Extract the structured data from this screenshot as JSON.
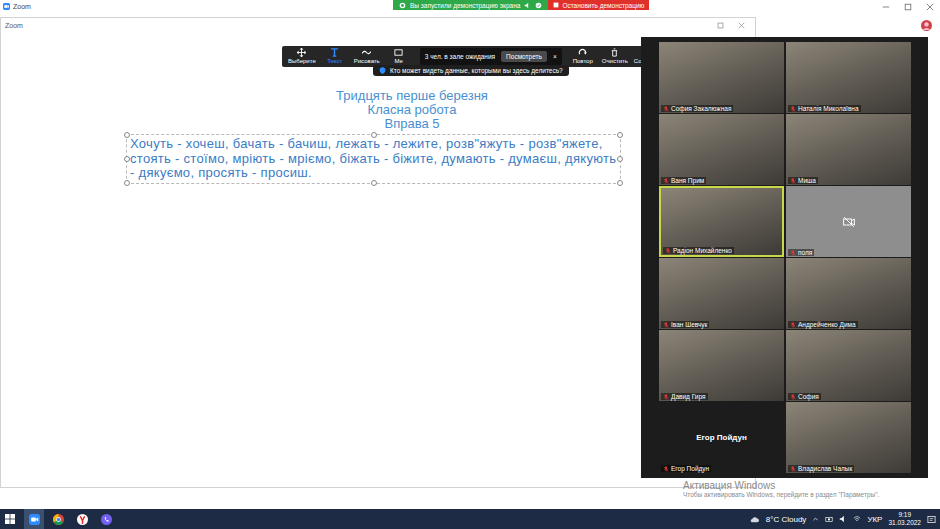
{
  "zoom_window": {
    "title": "Zoom"
  },
  "share_banner": {
    "text": "Вы запустили демонстрацию экрана",
    "stop_button": "Остановить демонстрацию"
  },
  "whiteboard_window": {
    "title": "Zoom"
  },
  "toolbar": {
    "tools": [
      {
        "label": "Выберите",
        "selected": false
      },
      {
        "label": "Текст",
        "selected": true
      },
      {
        "label": "Рисовать",
        "selected": false
      },
      {
        "label": "Ме",
        "selected": false
      },
      {
        "label": "Повтор",
        "selected": false
      },
      {
        "label": "Очистить",
        "selected": false
      },
      {
        "label": "Сохранить",
        "selected": false
      }
    ]
  },
  "waiting_popup": {
    "text": "3 чел. в зале ожидания",
    "button": "Посмотреть",
    "close": "×"
  },
  "privacy_hint": "Кто может видеть данные, которыми вы здесь делитесь?",
  "document": {
    "heading": [
      "Тридцять перше березня",
      "Класна робота",
      "Вправа 5"
    ],
    "exercise": "Хочуть - хочеш, бачать - бачиш, лежать - лежите, розв\"яжуть  - розв\"яжете, стоять - стоїмо, мріють - мріємо, біжать - біжите, думають - думаєш, дякують - дякуємо,  просять - просиш."
  },
  "participants": [
    {
      "name": "София Закалюжная",
      "kind": "video",
      "muted": true,
      "speaking": false
    },
    {
      "name": "Наталія Миколаївна",
      "kind": "video",
      "muted": true,
      "speaking": false
    },
    {
      "name": "Ваня Прим",
      "kind": "video",
      "muted": true,
      "speaking": false
    },
    {
      "name": "Миша",
      "kind": "video",
      "muted": true,
      "speaking": false
    },
    {
      "name": "Радіон Михайленко",
      "kind": "video",
      "muted": true,
      "speaking": true
    },
    {
      "name": "поля",
      "kind": "camoff",
      "muted": true,
      "speaking": false
    },
    {
      "name": "Іван Шевчук",
      "kind": "video",
      "muted": true,
      "speaking": false
    },
    {
      "name": "Андрейченко Дима",
      "kind": "video",
      "muted": true,
      "speaking": false
    },
    {
      "name": "Давид Гиря",
      "kind": "video",
      "muted": true,
      "speaking": false
    },
    {
      "name": "София",
      "kind": "video",
      "muted": true,
      "speaking": false
    },
    {
      "name": "Егор Пойдун",
      "kind": "nameonly",
      "muted": true,
      "speaking": false
    },
    {
      "name": "Владислав Чалык",
      "kind": "video",
      "muted": true,
      "speaking": false
    }
  ],
  "watermark": {
    "title": "Активация Windows",
    "hint": "Чтобы активировать Windows, перейдите в раздел \"Параметры\"."
  },
  "taskbar": {
    "apps": [
      {
        "selected": true
      },
      {
        "selected": false
      },
      {
        "selected": false
      },
      {
        "selected": false
      }
    ],
    "weather": "8°C Cloudy",
    "language": "УКР",
    "time": "9:19",
    "date": "31.03.2022"
  }
}
